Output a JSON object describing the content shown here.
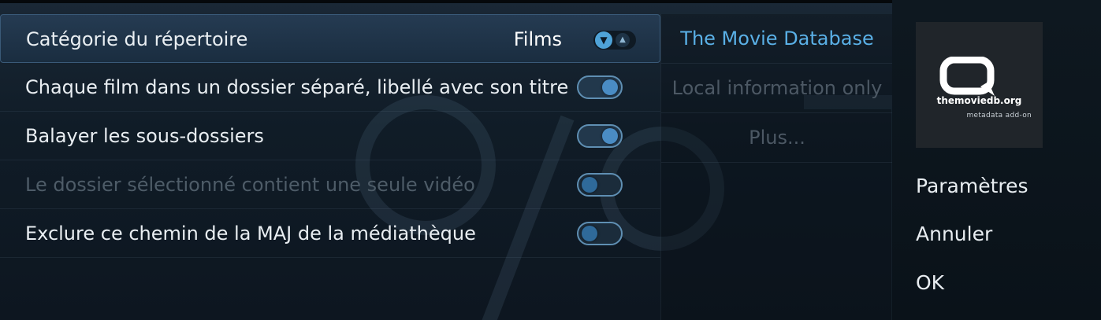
{
  "settings": {
    "category": {
      "label": "Catégorie du répertoire",
      "value": "Films"
    },
    "rows": [
      {
        "label": "Chaque film dans un dossier séparé, libellé avec son titre",
        "state": "on",
        "enabled": true
      },
      {
        "label": "Balayer les sous-dossiers",
        "state": "on",
        "enabled": true
      },
      {
        "label": "Le dossier sélectionné contient une seule vidéo",
        "state": "off",
        "enabled": false
      },
      {
        "label": "Exclure ce chemin de la MAJ de la médiathèque",
        "state": "off",
        "enabled": true
      }
    ]
  },
  "scrapers": {
    "items": [
      {
        "label": "The Movie Database",
        "active": true
      },
      {
        "label": "Local information only",
        "active": false
      },
      {
        "label": "Plus...",
        "active": false
      }
    ]
  },
  "addon": {
    "logo_name": "themoviedb.org",
    "logo_sub": "metadata add-on"
  },
  "actions": {
    "settings_label": "Paramètres",
    "cancel_label": "Annuler",
    "ok_label": "OK"
  },
  "colors": {
    "accent": "#5ab0e6",
    "toggle_knob": "#4a8cc4",
    "disabled_text": "#4e5c68"
  }
}
